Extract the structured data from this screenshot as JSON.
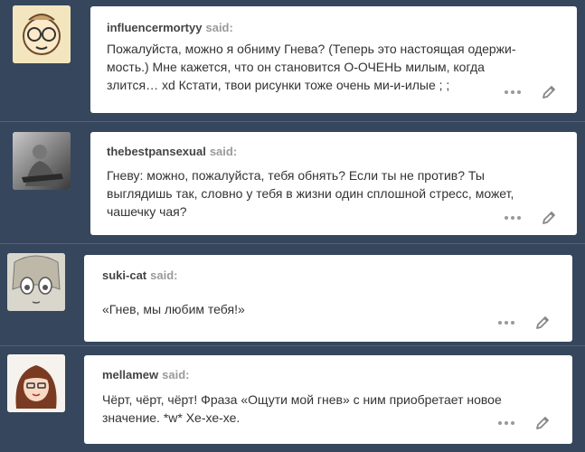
{
  "posts": [
    {
      "username": "influencermortyy",
      "said": "said:",
      "line1": "Пожалуйста, можно я обниму Гнева? (Теперь это настоящая одержи-",
      "line2": "мость.) Мне кажется, что он становится О-ОЧЕНЬ милым, когда",
      "line3": "злится… xd Кстати, твои рисунки тоже очень ми-и-илые ; ;"
    },
    {
      "username": "thebestpansexual",
      "said": "said:",
      "line1": "Гневу: можно, пожалуйста, тебя обнять? Если ты не против? Ты",
      "line2": "выглядишь так, словно у тебя в жизни один сплошной стресс, может,",
      "line3": "чашечку чая?"
    },
    {
      "username": "suki-cat",
      "said": "said:",
      "line1": "«Гнев, мы любим тебя!»"
    },
    {
      "username": "mellamew",
      "said": "said:",
      "line1": "Чёрт, чёрт, чёрт! Фраза «Ощути мой гнев» с ним приобретает новое",
      "line2": "значение. *w* Хе-хе-хе."
    }
  ],
  "colors": {
    "background": "#36465d",
    "card": "#ffffff",
    "username": "#444444",
    "said": "#9a9a9a"
  },
  "icons": [
    "more-options-icon",
    "edit-pencil-icon"
  ]
}
